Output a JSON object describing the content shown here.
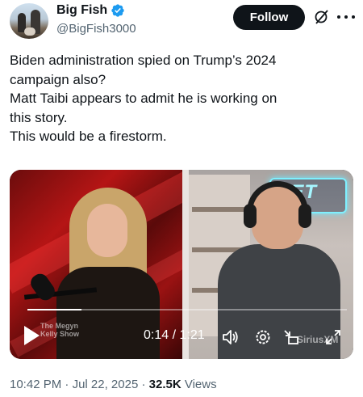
{
  "author": {
    "display_name": "Big Fish",
    "handle": "@BigFish3000",
    "verified": true,
    "verified_color": "#1d9bf0"
  },
  "header": {
    "follow_label": "Follow",
    "icons": [
      "grok-icon",
      "more-icon"
    ]
  },
  "tweet": {
    "lines": [
      "Biden administration spied on Trump’s 2024",
      "campaign also?",
      "Matt Taibi appears to admit he is working on",
      "this story.",
      "This would be a firestorm."
    ]
  },
  "video": {
    "neon_sign": "KET",
    "watermark": "The Megyn Kelly Show",
    "current_time": "0:14",
    "duration": "1:21",
    "time_display": "0:14 / 1:21",
    "progress_fraction": 0.17,
    "brand": "SiriusXM",
    "controls": [
      "play-icon",
      "volume-icon",
      "settings-icon",
      "minimize-icon",
      "fullscreen-icon"
    ]
  },
  "meta": {
    "time": "10:42 PM",
    "date": "Jul 22, 2025",
    "views_count": "32.5K",
    "views_label": "Views",
    "separator": "·"
  }
}
